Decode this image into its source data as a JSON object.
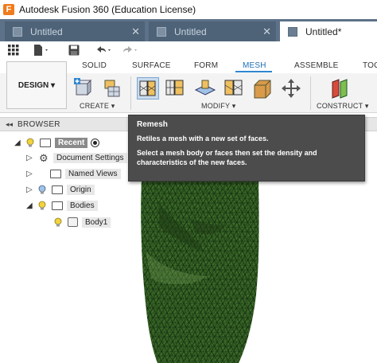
{
  "window": {
    "title": "Autodesk Fusion 360 (Education License)",
    "logo_letter": "F"
  },
  "tabs": [
    {
      "label": "Untitled",
      "close": "✕",
      "active": false
    },
    {
      "label": "Untitled",
      "close": "✕",
      "active": false
    },
    {
      "label": "Untitled*",
      "active": true
    }
  ],
  "quick_access": {
    "grid_icon": "grid-icon",
    "file_icon": "file-icon",
    "save_icon": "save-icon",
    "undo_icon": "undo-icon",
    "redo_icon": "redo-icon"
  },
  "ribbon_tabs": [
    "SOLID",
    "SURFACE",
    "FORM",
    "MESH",
    "ASSEMBLE",
    "TOO"
  ],
  "active_ribbon_tab": "MESH",
  "workspace": {
    "label": "DESIGN ▾"
  },
  "groups": {
    "create": "CREATE ▾",
    "modify": "MODIFY ▾",
    "construct": "CONSTRUCT ▾"
  },
  "browser": {
    "title": "BROWSER",
    "collapse_glyph": "◂◂",
    "root": "Recent",
    "items": [
      {
        "label": "Document Settings"
      },
      {
        "label": "Named Views"
      },
      {
        "label": "Origin"
      },
      {
        "label": "Bodies"
      },
      {
        "label": "Body1"
      }
    ]
  },
  "tooltip": {
    "title": "Remesh",
    "line1": "Retiles a mesh with a new set of faces.",
    "line2": "Select a mesh body or faces then set the density and",
    "line3": "characteristics of the new faces."
  },
  "colors": {
    "tab_strip": "#5d7288",
    "mesh_fill": "#3d6b2a",
    "mesh_line": "#0f2a0b",
    "accent": "#2f86d0"
  }
}
